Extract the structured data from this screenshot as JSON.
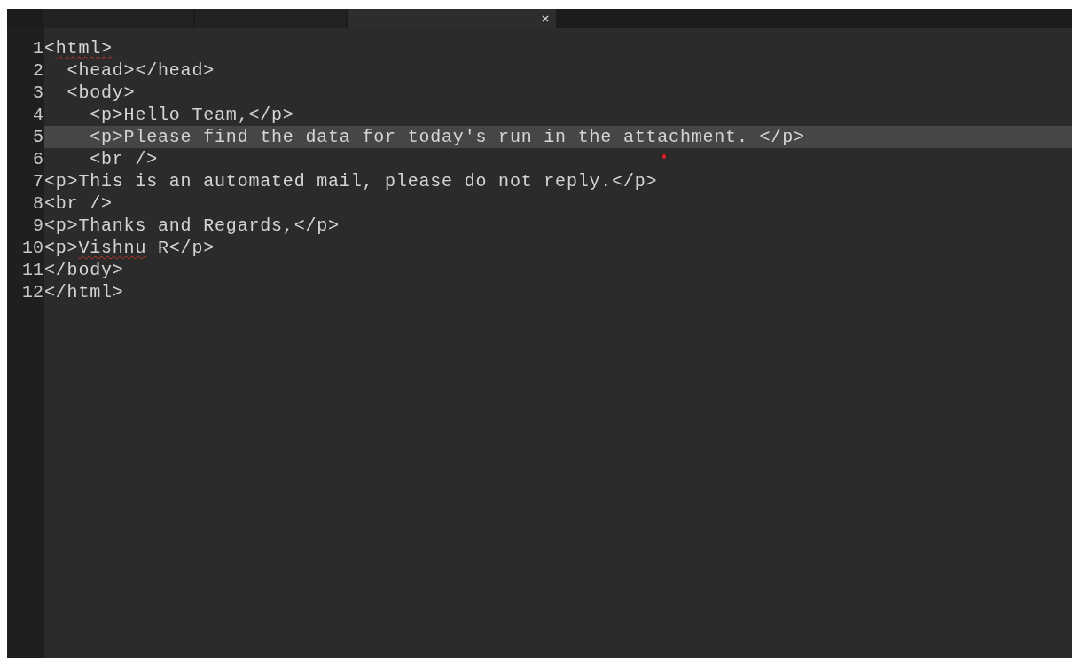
{
  "tabs": [
    {
      "selected": false
    },
    {
      "selected": false
    },
    {
      "selected": true
    }
  ],
  "editor": {
    "lines": [
      {
        "number": "1",
        "current": false,
        "segments": [
          {
            "text": "<",
            "misspelled": false
          },
          {
            "text": "html>",
            "misspelled": true
          }
        ]
      },
      {
        "number": "2",
        "current": false,
        "segments": [
          {
            "text": "  <head></head>",
            "misspelled": false
          }
        ]
      },
      {
        "number": "3",
        "current": false,
        "segments": [
          {
            "text": "  <body>",
            "misspelled": false
          }
        ]
      },
      {
        "number": "4",
        "current": false,
        "segments": [
          {
            "text": "    <p>Hello Team,</p>",
            "misspelled": false
          }
        ]
      },
      {
        "number": "5",
        "current": true,
        "segments": [
          {
            "text": "    <p>Please find the data for today's run in the attachment. </p>",
            "misspelled": false
          }
        ]
      },
      {
        "number": "6",
        "current": false,
        "segments": [
          {
            "text": "    <br />",
            "misspelled": false
          }
        ]
      },
      {
        "number": "7",
        "current": false,
        "segments": [
          {
            "text": "<p>This is an automated mail, please do not reply.</p>",
            "misspelled": false
          }
        ]
      },
      {
        "number": "8",
        "current": false,
        "segments": [
          {
            "text": "<br />",
            "misspelled": false
          }
        ]
      },
      {
        "number": "9",
        "current": false,
        "segments": [
          {
            "text": "<p>Thanks and Regards,</p>",
            "misspelled": false
          }
        ]
      },
      {
        "number": "10",
        "current": false,
        "segments": [
          {
            "text": "<p>",
            "misspelled": false
          },
          {
            "text": "Vishnu",
            "misspelled": true
          },
          {
            "text": " R</p>",
            "misspelled": false
          }
        ]
      },
      {
        "number": "11",
        "current": false,
        "segments": [
          {
            "text": "</body>",
            "misspelled": false
          }
        ]
      },
      {
        "number": "12",
        "current": false,
        "segments": [
          {
            "text": "</html>",
            "misspelled": false
          }
        ]
      }
    ]
  }
}
